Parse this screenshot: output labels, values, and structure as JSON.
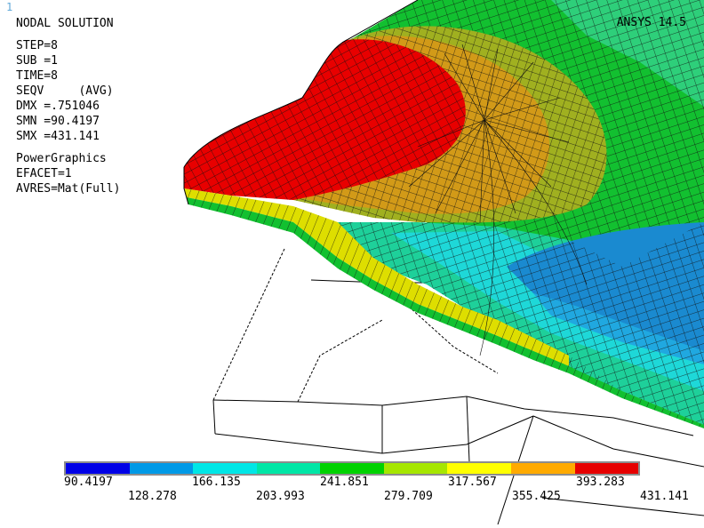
{
  "window": {
    "number": "1"
  },
  "header": {
    "title": "NODAL SOLUTION",
    "program": "ANSYS 14.5"
  },
  "solution": {
    "step": "STEP=8",
    "sub": "SUB =1",
    "time": "TIME=8",
    "result": "SEQV     (AVG)",
    "dmx": "DMX =.751046",
    "smn": "SMN =90.4197",
    "smx": "SMX =431.141"
  },
  "graphics": {
    "mode": "PowerGraphics",
    "efacet": "EFACET=1",
    "avres": "AVRES=Mat(Full)"
  },
  "legend": {
    "colors": [
      "#0000e6",
      "#0099e6",
      "#00e6e6",
      "#00e6a6",
      "#00d200",
      "#a6e600",
      "#ffff00",
      "#ffaa00",
      "#e60000"
    ],
    "labels_top": [
      "90.4197",
      "166.135",
      "241.851",
      "317.567",
      "393.283"
    ],
    "labels_bottom": [
      "128.278",
      "203.993",
      "279.709",
      "355.425",
      "431.141"
    ]
  },
  "model_colors": {
    "red": "#e80000",
    "orange": "#d29a18",
    "olive": "#a0b020",
    "green": "#12c030",
    "green_light": "#3ec85a",
    "teal": "#1ed09a",
    "cyan": "#1ed8d8",
    "blue": "#1a8ad0",
    "blue_mid": "#20a8e0",
    "yellow": "#dede00",
    "lime": "#9ae600",
    "mesh": "#141414"
  }
}
